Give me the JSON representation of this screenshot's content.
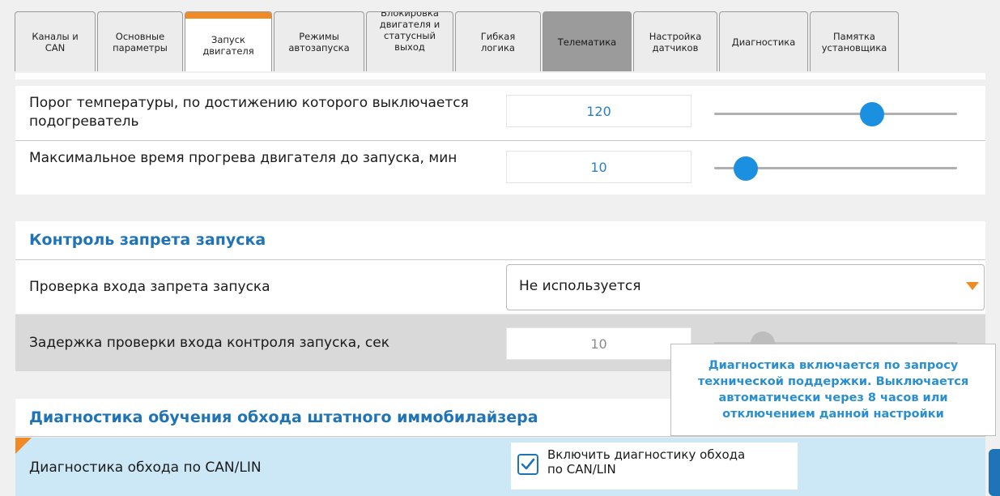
{
  "tabs": [
    {
      "label": "Каналы и\nCAN",
      "state": "normal"
    },
    {
      "label": "Основные\nпараметры",
      "state": "normal"
    },
    {
      "label": "Запуск\nдвигателя",
      "state": "active"
    },
    {
      "label": "Режимы\nавтозапуска",
      "state": "normal"
    },
    {
      "label": "Блокировка\nдвигателя и\nстатусный\nвыход",
      "state": "normal"
    },
    {
      "label": "Гибкая\nлогика",
      "state": "normal"
    },
    {
      "label": "Телематика",
      "state": "hover"
    },
    {
      "label": "Настройка\nдатчиков",
      "state": "normal"
    },
    {
      "label": "Диагностика",
      "state": "normal"
    },
    {
      "label": "Памятка\nустановщика",
      "state": "normal"
    }
  ],
  "heater": {
    "temp_threshold": {
      "label": "Порог температуры, по достижению которого выключается подогреватель",
      "value": "120",
      "slider_fraction": 0.65
    },
    "max_warmup": {
      "label": "Максимальное время прогрева двигателя до запуска, мин",
      "value": "10",
      "slider_fraction": 0.13
    }
  },
  "start_ban": {
    "title": "Контроль запрета запуска",
    "check_input": {
      "label": "Проверка входа запрета запуска",
      "selected": "Не используется"
    },
    "check_delay": {
      "label": "Задержка проверки входа контроля запуска, сек",
      "value": "10",
      "disabled": true
    }
  },
  "immo": {
    "title": "Диагностика обучения обхода штатного иммобилайзера",
    "bypass": {
      "label": "Диагностика обхода по CAN/LIN",
      "checkbox_label": "Включить диагностику обхода\nпо CAN/LIN",
      "checked": true
    }
  },
  "tooltip": {
    "text": "Диагностика включается по запросу\nтехнической поддержки. Выключается\nавтоматически через 8 часов или\nотключением данной настройки"
  },
  "colors": {
    "accent_blue": "#1f73b7",
    "accent_orange": "#f08a24",
    "slider_blue": "#1b8fe0",
    "row_highlight": "#cce8f7"
  }
}
